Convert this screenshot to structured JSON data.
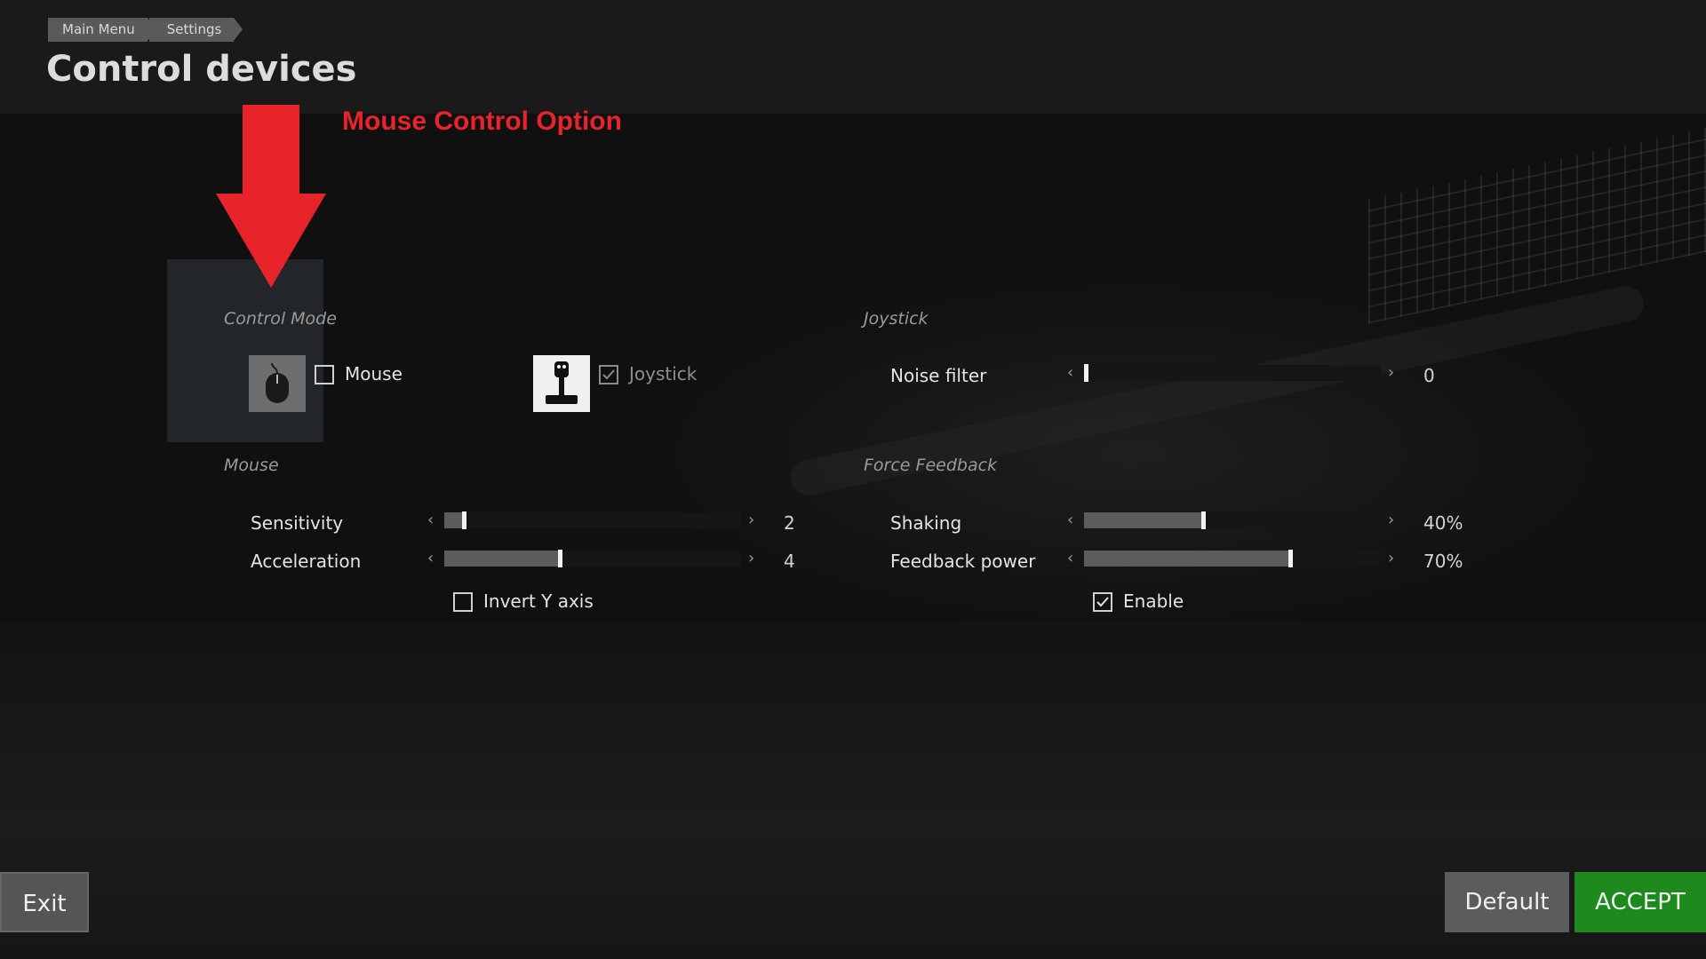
{
  "breadcrumb": [
    "Main Menu",
    "Settings"
  ],
  "page_title": "Control devices",
  "annotation": {
    "text": "Mouse Control Option",
    "color": "#e8232a"
  },
  "control_mode": {
    "label": "Control Mode",
    "options": [
      {
        "label": "Mouse",
        "icon": "mouse-icon",
        "checked": false
      },
      {
        "label": "Joystick",
        "icon": "joystick-icon",
        "checked": true
      }
    ]
  },
  "mouse": {
    "label": "Mouse",
    "sensitivity": {
      "label": "Sensitivity",
      "value": "2",
      "level": 0.06
    },
    "acceleration": {
      "label": "Acceleration",
      "value": "4",
      "level": 0.39
    },
    "invert_y": {
      "label": "Invert Y axis",
      "checked": false
    }
  },
  "joystick": {
    "label": "Joystick",
    "noise_filter": {
      "label": "Noise filter",
      "value": "0",
      "level": 0.0
    }
  },
  "force_feedback": {
    "label": "Force Feedback",
    "shaking": {
      "label": "Shaking",
      "value": "40%",
      "level": 0.4
    },
    "feedback_power": {
      "label": "Feedback power",
      "value": "70%",
      "level": 0.7
    },
    "enable": {
      "label": "Enable",
      "checked": true
    }
  },
  "buttons": {
    "exit": "Exit",
    "default": "Default",
    "accept": "ACCEPT"
  },
  "colors": {
    "accept": "#1e8a1e",
    "annotation": "#e8232a"
  }
}
